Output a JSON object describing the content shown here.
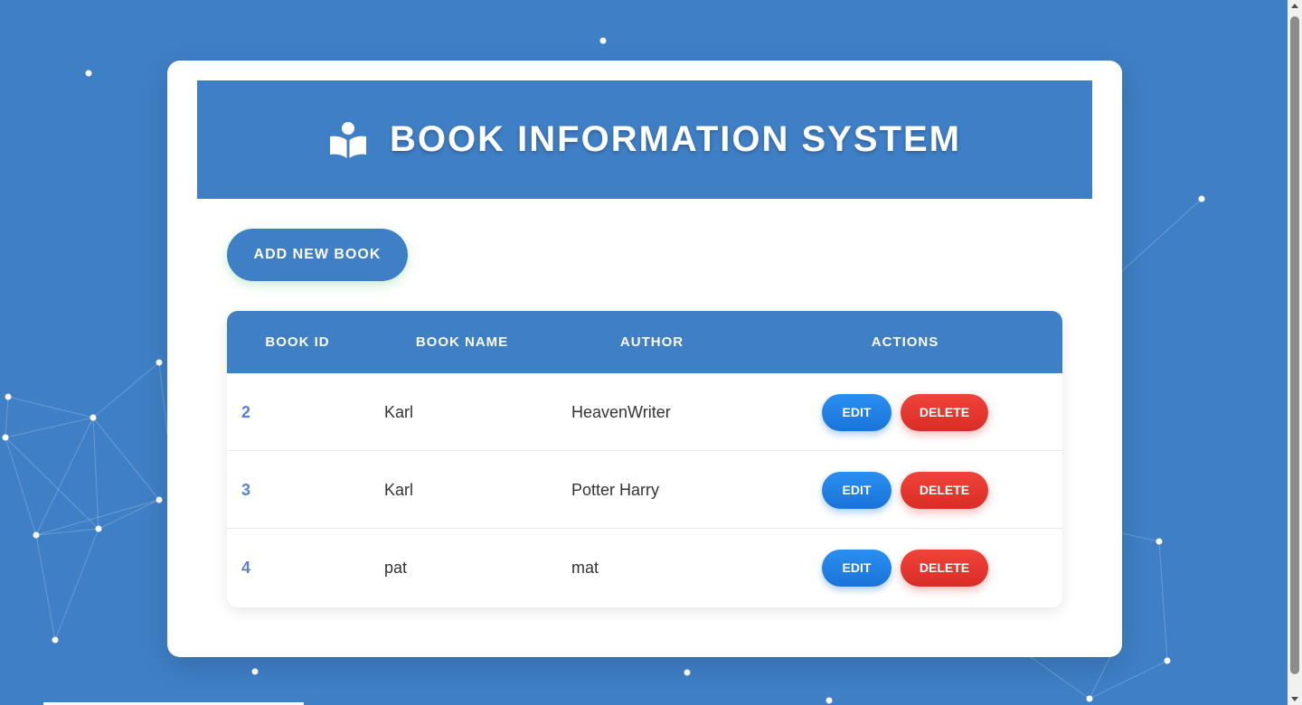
{
  "colors": {
    "background": "#3f7fc6",
    "card": "#ffffff",
    "header": "#3f7fc6",
    "edit": "#1f80e6",
    "delete": "#e53a33",
    "id_text": "#5b7fd6"
  },
  "header": {
    "icon": "book-reader-icon",
    "title": "BOOK INFORMATION SYSTEM"
  },
  "toolbar": {
    "add_label": "ADD NEW BOOK"
  },
  "table": {
    "columns": {
      "id": "BOOK ID",
      "name": "BOOK NAME",
      "author": "AUTHOR",
      "actions": "ACTIONS"
    },
    "rows": [
      {
        "id": "2",
        "name": "Karl",
        "author": "HeavenWriter",
        "edit": "EDIT",
        "delete": "DELETE"
      },
      {
        "id": "3",
        "name": "Karl",
        "author": "Potter Harry",
        "edit": "EDIT",
        "delete": "DELETE"
      },
      {
        "id": "4",
        "name": "pat",
        "author": "mat",
        "edit": "EDIT",
        "delete": "DELETE"
      }
    ]
  }
}
